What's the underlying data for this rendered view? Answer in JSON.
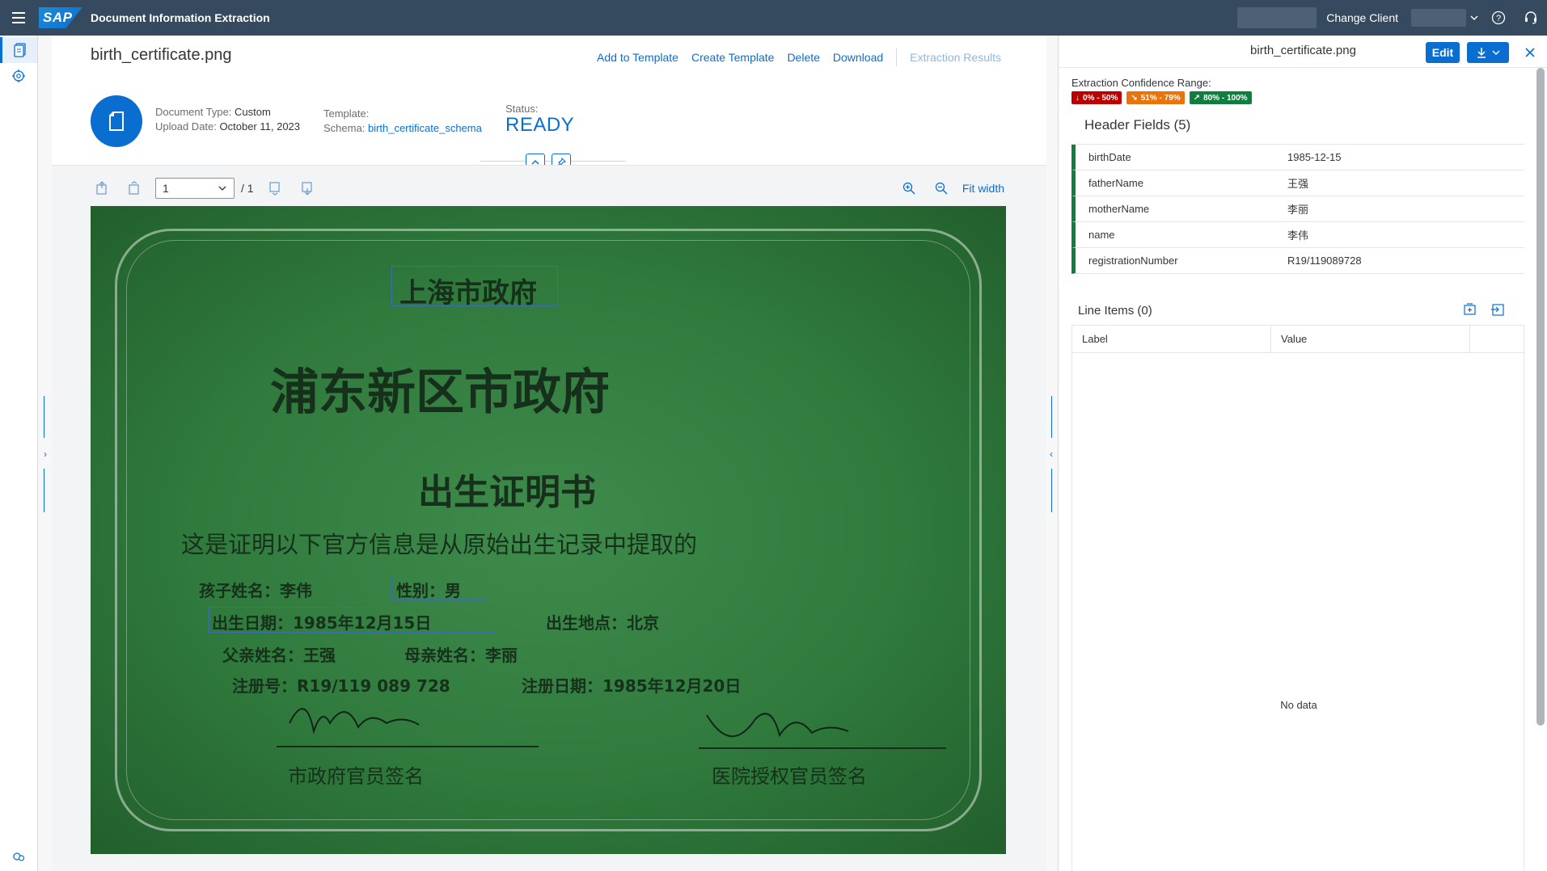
{
  "shell": {
    "app_title": "Document Information Extraction",
    "logo_text": "SAP",
    "change_client": "Change Client"
  },
  "document": {
    "file_name": "birth_certificate.png",
    "actions": {
      "add_to_template": "Add to Template",
      "create_template": "Create Template",
      "delete": "Delete",
      "download": "Download",
      "extraction_results": "Extraction Results"
    },
    "meta": {
      "doc_type_label": "Document Type:",
      "doc_type_value": "Custom",
      "upload_date_label": "Upload Date:",
      "upload_date_value": "October 11, 2023",
      "template_label": "Template:",
      "schema_label": "Schema:",
      "schema_value": "birth_certificate_schema",
      "status_label": "Status:",
      "status_value": "READY"
    }
  },
  "viewer": {
    "page_value": "1",
    "page_total": "/ 1",
    "fit_width": "Fit width"
  },
  "certificate": {
    "line1": "上海市政府",
    "line2": "浦东新区市政府",
    "line3": "出生证明书",
    "line4": "这是证明以下官方信息是从原始出生记录中提取的",
    "child_name": "孩子姓名：李伟",
    "gender": "性别：男",
    "birth_date": "出生日期：1985年12月15日",
    "birth_place": "出生地点：北京",
    "father_name": "父亲姓名：王强",
    "mother_name": "母亲姓名：李丽",
    "reg_no": "注册号：R19/119 089 728",
    "reg_date": "注册日期：1985年12月20日",
    "sign_left": "市政府官员签名",
    "sign_right": "医院授权官员签名"
  },
  "right_panel": {
    "title": "birth_certificate.png",
    "edit": "Edit",
    "confidence_label": "Extraction Confidence Range:",
    "badges": [
      {
        "label": "0% - 50%",
        "color": "#bb0000",
        "arrow": "↓"
      },
      {
        "label": "51% - 79%",
        "color": "#e9730c",
        "arrow": "↘"
      },
      {
        "label": "80% - 100%",
        "color": "#107e3e",
        "arrow": "↗"
      }
    ],
    "header_fields_title": "Header Fields (5)",
    "header_fields": [
      {
        "key": "birthDate",
        "value": "1985-12-15"
      },
      {
        "key": "fatherName",
        "value": "王强"
      },
      {
        "key": "motherName",
        "value": "李丽"
      },
      {
        "key": "name",
        "value": "李伟"
      },
      {
        "key": "registrationNumber",
        "value": "R19/119089728"
      }
    ],
    "line_items_title": "Line Items (0)",
    "line_items_columns": [
      "Label",
      "Value"
    ],
    "no_data": "No data"
  }
}
